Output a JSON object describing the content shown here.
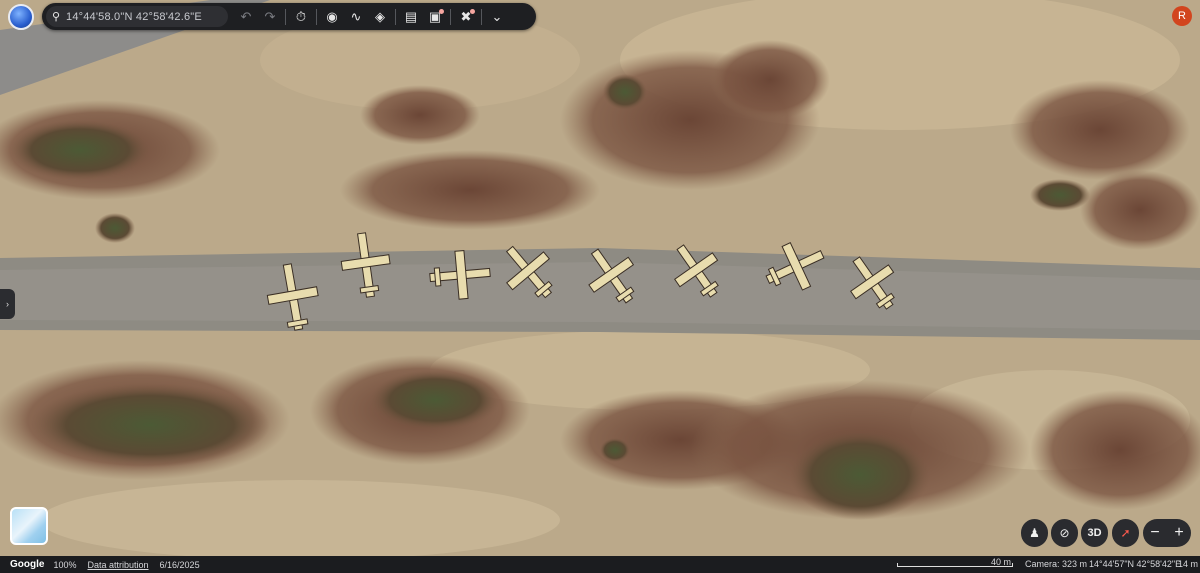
{
  "search": {
    "value": "14°44'58.0\"N 42°58'42.6\"E"
  },
  "toolbar": {
    "undo_icon": "undo-icon",
    "redo_icon": "redo-icon",
    "history_icon": "history-icon",
    "pin_icon": "map-pin-icon",
    "path_icon": "path-icon",
    "layers_icon": "layers-icon",
    "measure_icon": "ruler-icon",
    "add_image_icon": "add-image-icon",
    "tools_icon": "tools-icon",
    "expand_icon": "chevron-down-icon"
  },
  "user": {
    "initial": "R"
  },
  "controls": {
    "three_d": "3D",
    "zoom_out": "−",
    "zoom_in": "+"
  },
  "status": {
    "brand": "Google",
    "zoom_pct": "100%",
    "attribution": "Data attribution",
    "date": "6/16/2025",
    "scale_label": "40 m",
    "camera": "Camera: 323 m",
    "coords": "14°44'57\"N 42°58'42\"E",
    "altitude": "14 m"
  },
  "colors": {
    "accent_avatar": "#d2451e",
    "bar": "#1e1f22"
  }
}
